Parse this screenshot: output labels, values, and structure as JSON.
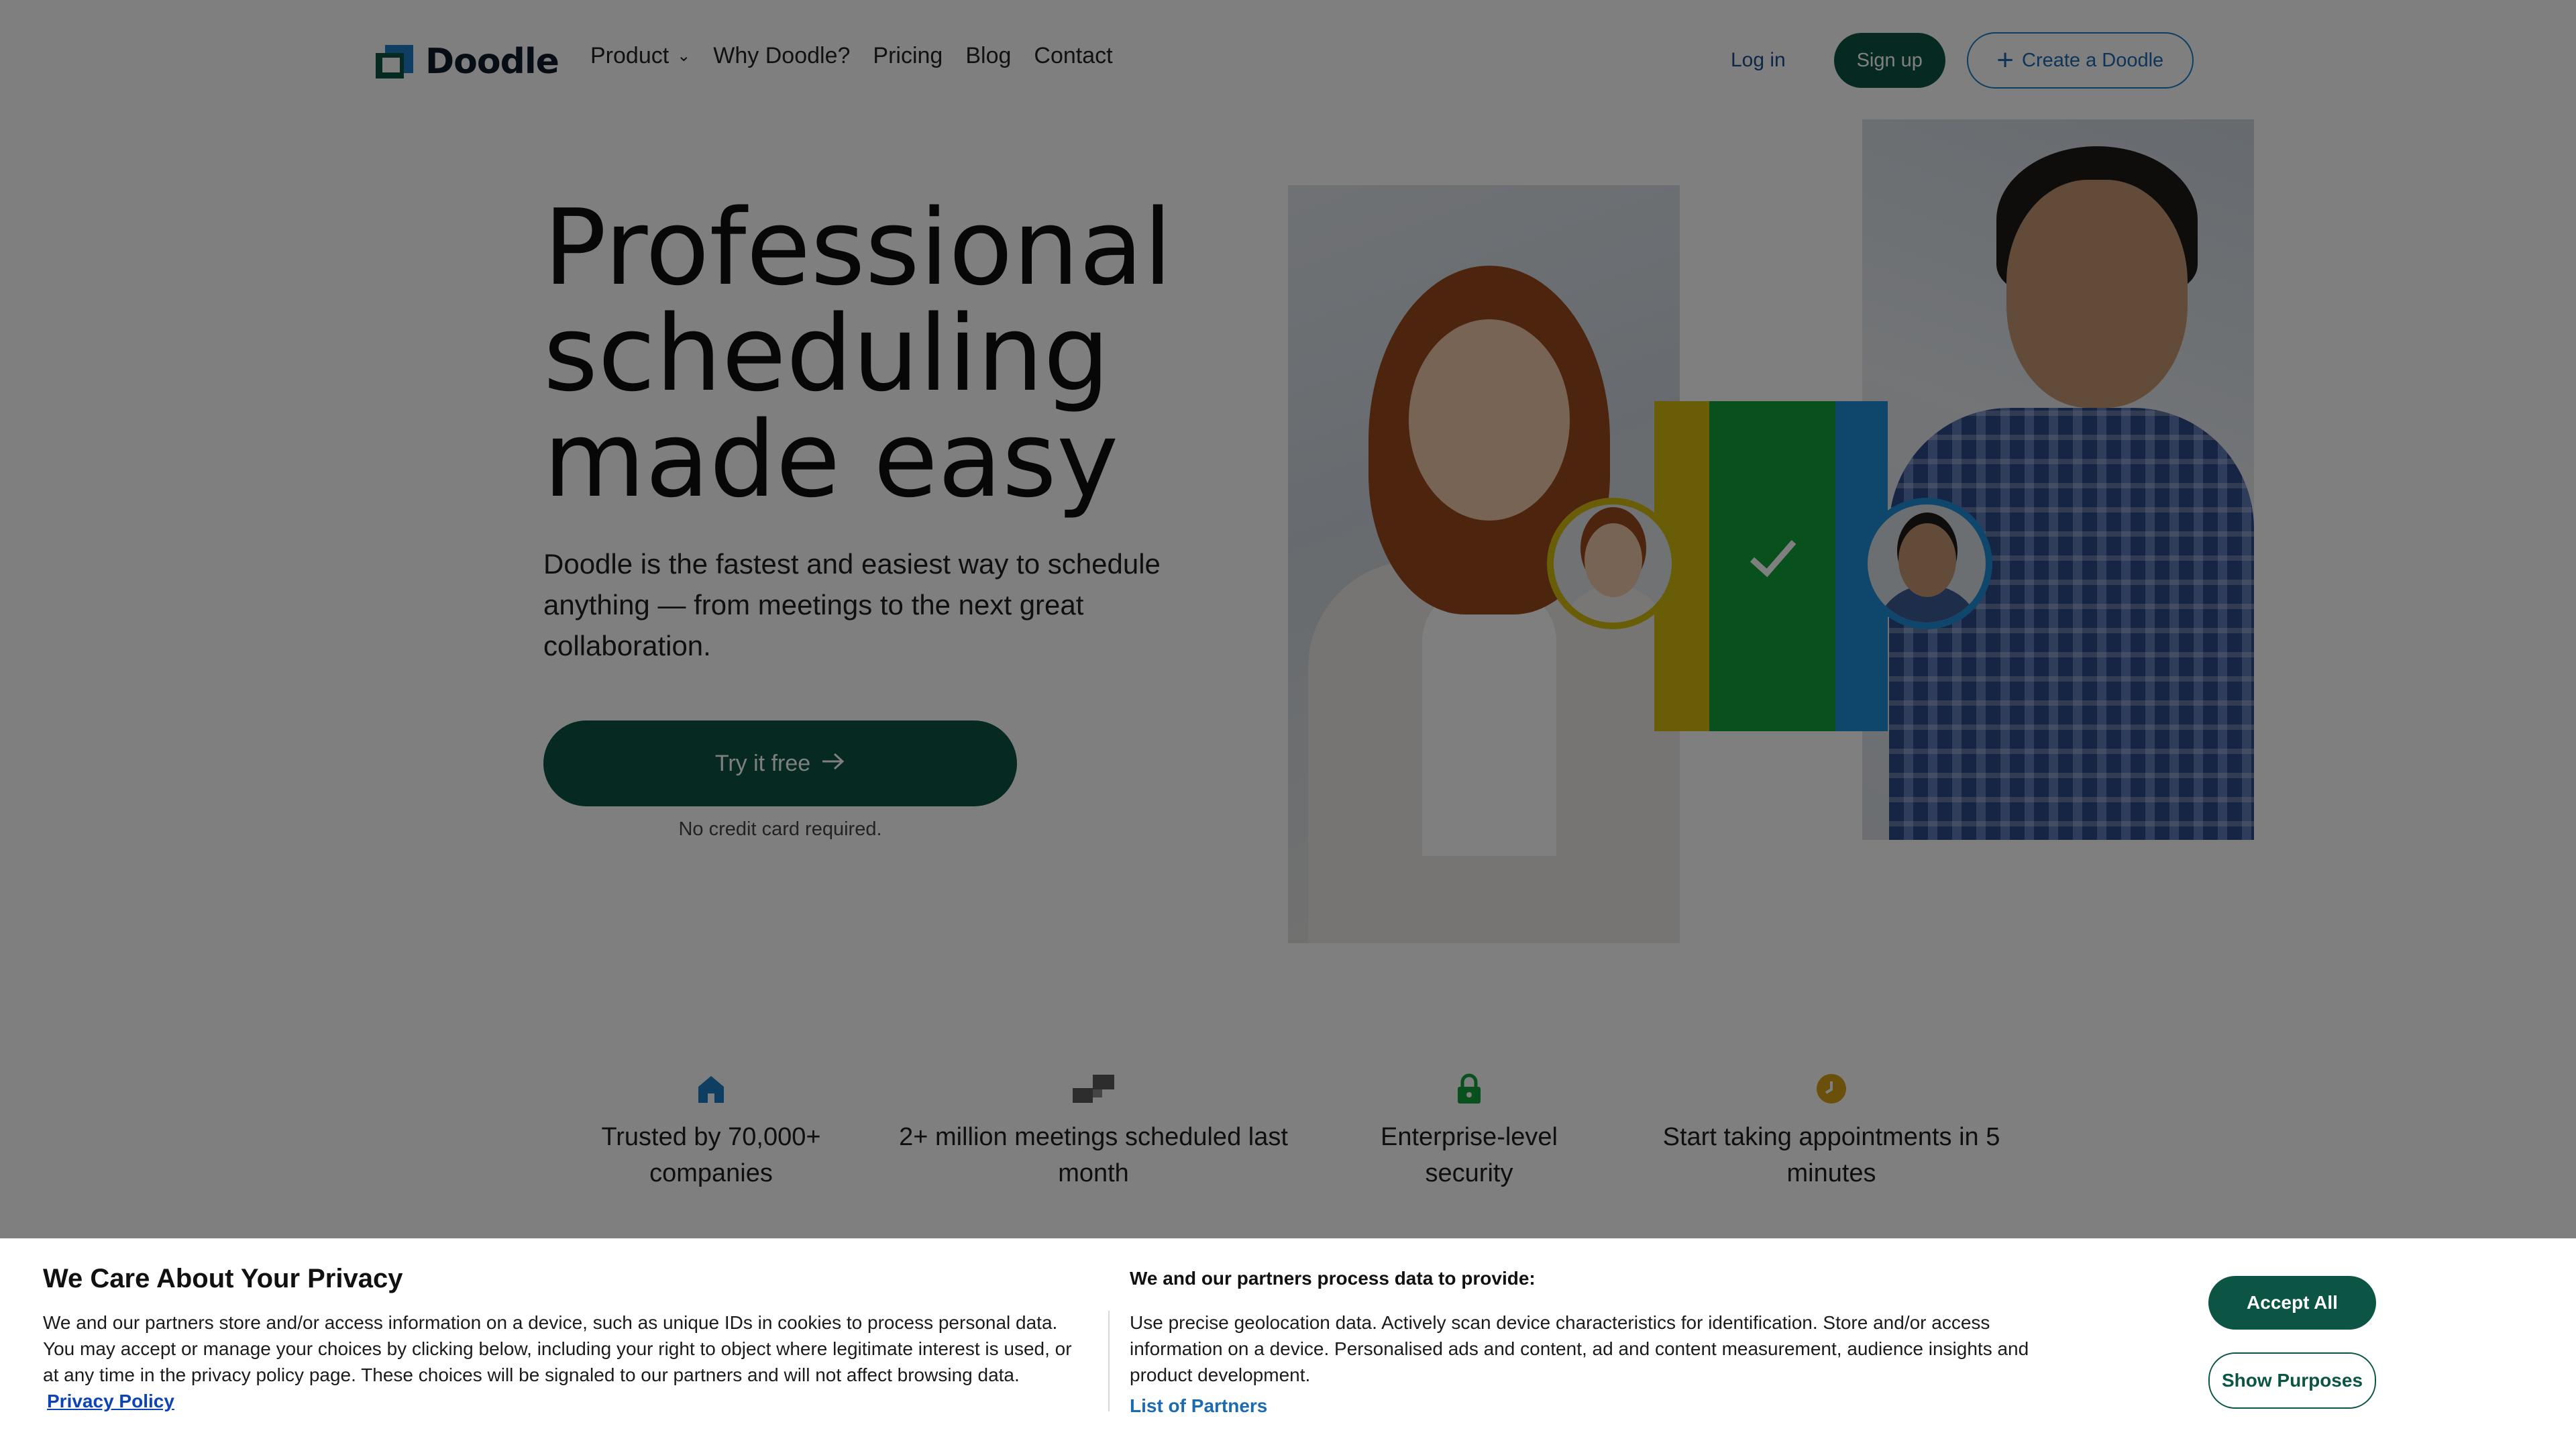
{
  "header": {
    "logo_text": "Doodle",
    "nav": [
      {
        "label": "Product",
        "has_dropdown": true
      },
      {
        "label": "Why Doodle?"
      },
      {
        "label": "Pricing"
      },
      {
        "label": "Blog"
      },
      {
        "label": "Contact"
      }
    ],
    "login_label": "Log in",
    "signup_label": "Sign up",
    "create_label": "Create a Doodle"
  },
  "hero": {
    "title_lines": [
      "Professional",
      "scheduling",
      "made easy"
    ],
    "subtitle": "Doodle is the fastest and easiest way to schedule anything — from meetings to the next great collaboration.",
    "cta_label": "Try it free",
    "cta_note": "No credit card required."
  },
  "features": [
    {
      "icon": "house-icon",
      "text": "Trusted by 70,000+ companies",
      "color": "#1c7ec4"
    },
    {
      "icon": "blocks-icon",
      "text": "2+ million meetings scheduled last month",
      "color": "#4a4a4a"
    },
    {
      "icon": "lock-icon",
      "text": "Enterprise-level security",
      "color": "#10a33a"
    },
    {
      "icon": "clock-icon",
      "text": "Start taking appointments in 5 minutes",
      "color": "#d6a017"
    }
  ],
  "consent": {
    "title": "We Care About Your Privacy",
    "text": "We and our partners store and/or access information on a device, such as unique IDs in cookies to process personal data. You may accept or manage your choices by clicking below, including your right to object where legitimate interest is used, or at any time in the privacy policy page. These choices will be signaled to our partners and will not affect browsing data.",
    "privacy_link": "Privacy Policy",
    "purposes_title": "We and our partners process data to provide:",
    "purposes_text": "Use precise geolocation data. Actively scan device characteristics for identification. Store and/or access information on a device. Personalised ads and content, ad and content measurement, audience insights and product development.",
    "partners_link": "List of Partners",
    "accept_label": "Accept All",
    "show_purposes_label": "Show Purposes"
  },
  "colors": {
    "brand_green": "#0c5545",
    "brand_blue": "#1c7ec4",
    "accent_yellow": "#d3bd0e",
    "accent_green": "#10a33a"
  }
}
